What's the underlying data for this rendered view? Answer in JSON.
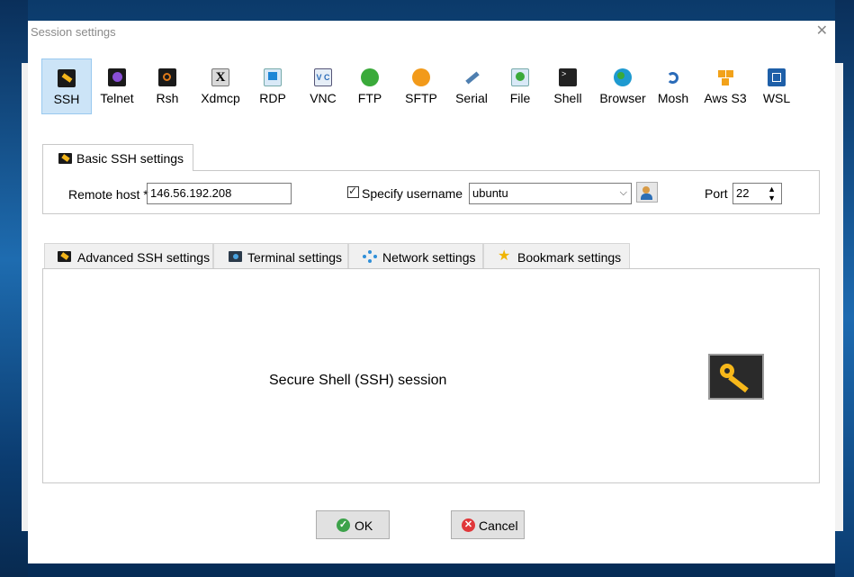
{
  "window": {
    "title": "Session settings",
    "close": "✕"
  },
  "session_types": [
    {
      "label": "SSH",
      "icon": "ssh-key-icon",
      "color": "#f2b51b",
      "selected": true
    },
    {
      "label": "Telnet",
      "icon": "telnet-icon",
      "color": "#8a4fd6"
    },
    {
      "label": "Rsh",
      "icon": "rsh-icon",
      "color": "#e07a1a"
    },
    {
      "label": "Xdmcp",
      "icon": "xdmcp-icon",
      "color": "#333333"
    },
    {
      "label": "RDP",
      "icon": "rdp-icon",
      "color": "#1e86d6"
    },
    {
      "label": "VNC",
      "icon": "vnc-icon",
      "color": "#2a6bb8"
    },
    {
      "label": "FTP",
      "icon": "ftp-globe-icon",
      "color": "#3aaa3a"
    },
    {
      "label": "SFTP",
      "icon": "sftp-globe-icon",
      "color": "#f29a1a"
    },
    {
      "label": "Serial",
      "icon": "serial-icon",
      "color": "#4f7fb0"
    },
    {
      "label": "File",
      "icon": "file-icon",
      "color": "#3a8fd0"
    },
    {
      "label": "Shell",
      "icon": "shell-icon",
      "color": "#222222"
    },
    {
      "label": "Browser",
      "icon": "browser-globe-icon",
      "color": "#1e9ad0"
    },
    {
      "label": "Mosh",
      "icon": "mosh-icon",
      "color": "#2a6bb8"
    },
    {
      "label": "Aws S3",
      "icon": "aws-s3-icon",
      "color": "#f2a21a"
    },
    {
      "label": "WSL",
      "icon": "wsl-icon",
      "color": "#1e5fa8"
    }
  ],
  "basic": {
    "tab_label": "Basic SSH settings",
    "remote_host_label": "Remote host *",
    "remote_host_value": "146.56.192.208",
    "specify_username_label": "Specify username",
    "specify_username_checked": true,
    "username_value": "ubuntu",
    "port_label": "Port",
    "port_value": "22"
  },
  "advanced_tabs": [
    {
      "label": "Advanced SSH settings",
      "icon": "ssh-key-icon"
    },
    {
      "label": "Terminal settings",
      "icon": "terminal-icon"
    },
    {
      "label": "Network settings",
      "icon": "network-icon"
    },
    {
      "label": "Bookmark settings",
      "icon": "star-icon"
    }
  ],
  "panel": {
    "description": "Secure Shell (SSH) session"
  },
  "buttons": {
    "ok": "OK",
    "cancel": "Cancel"
  }
}
